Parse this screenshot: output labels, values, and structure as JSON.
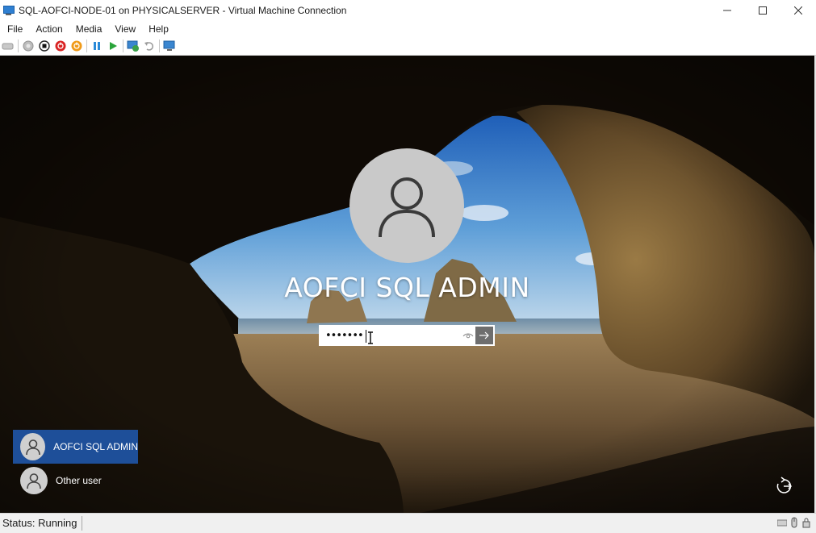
{
  "window": {
    "title": "SQL-AOFCI-NODE-01 on PHYSICALSERVER - Virtual Machine Connection"
  },
  "menu": {
    "items": [
      "File",
      "Action",
      "Media",
      "View",
      "Help"
    ]
  },
  "toolbar": {
    "icons": [
      "ctrl-alt-del-icon",
      "start-icon",
      "turn-off-icon",
      "shut-down-icon",
      "save-icon",
      "pause-icon",
      "resume-icon",
      "checkpoint-icon",
      "revert-icon",
      "enhanced-session-icon"
    ]
  },
  "login": {
    "user_name": "AOFCI SQL ADMIN",
    "password_value": "•••••••",
    "users": [
      {
        "label": "AOFCI SQL ADMIN",
        "selected": true
      },
      {
        "label": "Other user",
        "selected": false
      }
    ]
  },
  "status": {
    "text": "Status: Running"
  },
  "colors": {
    "selected_user_bg": "#1e4f99",
    "avatar_bg": "#c9c9c9"
  }
}
